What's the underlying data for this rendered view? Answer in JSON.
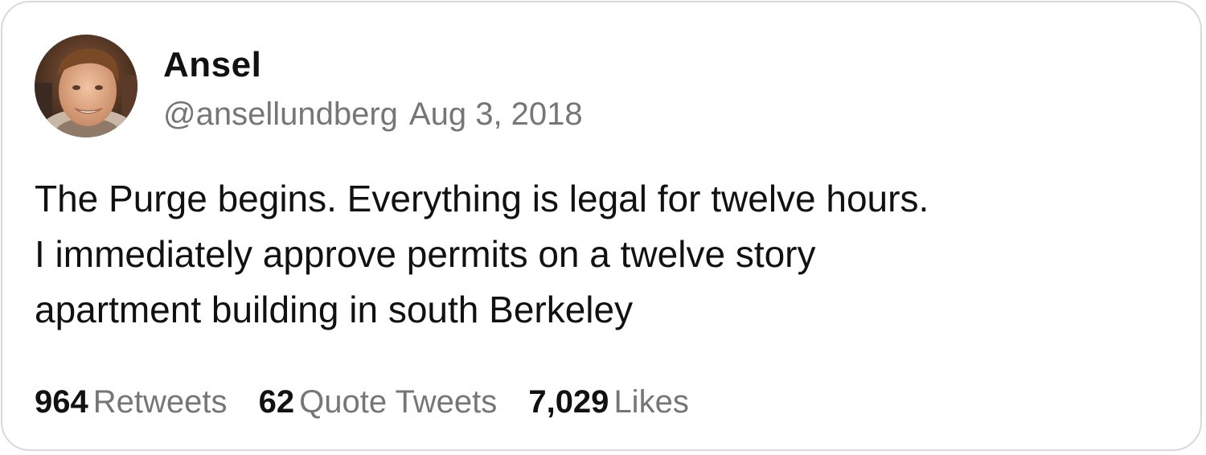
{
  "tweet": {
    "author": {
      "display_name": "Ansel",
      "handle": "@ansellundberg",
      "avatar": "profile-photo"
    },
    "date": "Aug 3, 2018",
    "text_lines": [
      "The Purge begins. Everything is legal for twelve hours.",
      "I immediately approve permits on a twelve story",
      "apartment building in south Berkeley"
    ],
    "stats": [
      {
        "count": "964",
        "label": "Retweets"
      },
      {
        "count": "62",
        "label": "Quote Tweets"
      },
      {
        "count": "7,029",
        "label": "Likes"
      }
    ]
  },
  "colors": {
    "text_primary": "#111111",
    "text_secondary": "#767676",
    "border": "#d9d9d9",
    "background": "#ffffff"
  }
}
